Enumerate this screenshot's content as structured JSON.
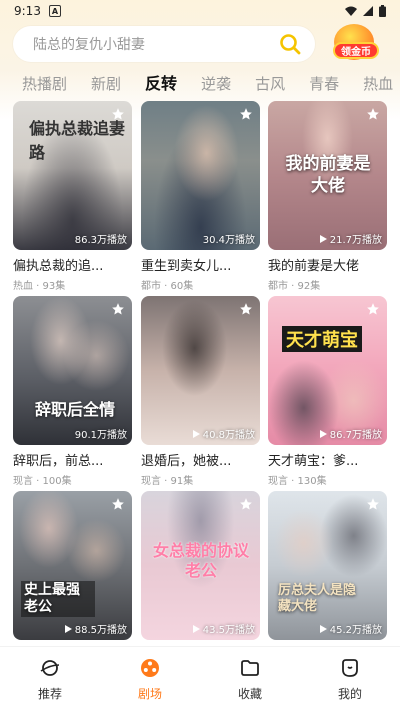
{
  "status_bar": {
    "time": "9:13",
    "a_badge": "A"
  },
  "search": {
    "placeholder": "陆总的复仇小甜妻"
  },
  "coin_button": {
    "label": "领金币"
  },
  "tabs": [
    {
      "label": "热播剧",
      "active": false
    },
    {
      "label": "新剧",
      "active": false
    },
    {
      "label": "反转",
      "active": true
    },
    {
      "label": "逆袭",
      "active": false
    },
    {
      "label": "古风",
      "active": false
    },
    {
      "label": "青春",
      "active": false
    },
    {
      "label": "热血",
      "active": false
    }
  ],
  "cards": [
    {
      "title": "偏执总裁的追...",
      "views": "86.3万播放",
      "genre": "热血",
      "episodes": "93集",
      "poster_text": "偏执总裁追妻路"
    },
    {
      "title": "重生到卖女儿...",
      "views": "30.4万播放",
      "genre": "都市",
      "episodes": "60集",
      "poster_text": ""
    },
    {
      "title": "我的前妻是大佬",
      "views": "21.7万播放",
      "genre": "都市",
      "episodes": "92集",
      "poster_text": "我的前妻是大佬"
    },
    {
      "title": "辞职后，前总...",
      "views": "90.1万播放",
      "genre": "现言",
      "episodes": "100集",
      "poster_text": "辞职后全情"
    },
    {
      "title": "退婚后，她被...",
      "views": "40.8万播放",
      "genre": "现言",
      "episodes": "91集",
      "poster_text": ""
    },
    {
      "title": "天才萌宝：爹...",
      "views": "86.7万播放",
      "genre": "现言",
      "episodes": "130集",
      "poster_text": "天才萌宝"
    },
    {
      "title": "",
      "views": "88.5万播放",
      "genre": "",
      "episodes": "",
      "poster_text": "史上最强老公"
    },
    {
      "title": "",
      "views": "43.5万播放",
      "genre": "",
      "episodes": "",
      "poster_text": "女总裁的协议老公"
    },
    {
      "title": "",
      "views": "45.2万播放",
      "genre": "",
      "episodes": "",
      "poster_text": "厉总夫人是隐藏大佬"
    }
  ],
  "bottom_nav": [
    {
      "label": "推荐",
      "active": false
    },
    {
      "label": "剧场",
      "active": true
    },
    {
      "label": "收藏",
      "active": false
    },
    {
      "label": "我的",
      "active": false
    }
  ],
  "colors": {
    "accent": "#ff7a1a",
    "search_icon": "#f5c400",
    "coin_badge": "#ff3b30"
  }
}
